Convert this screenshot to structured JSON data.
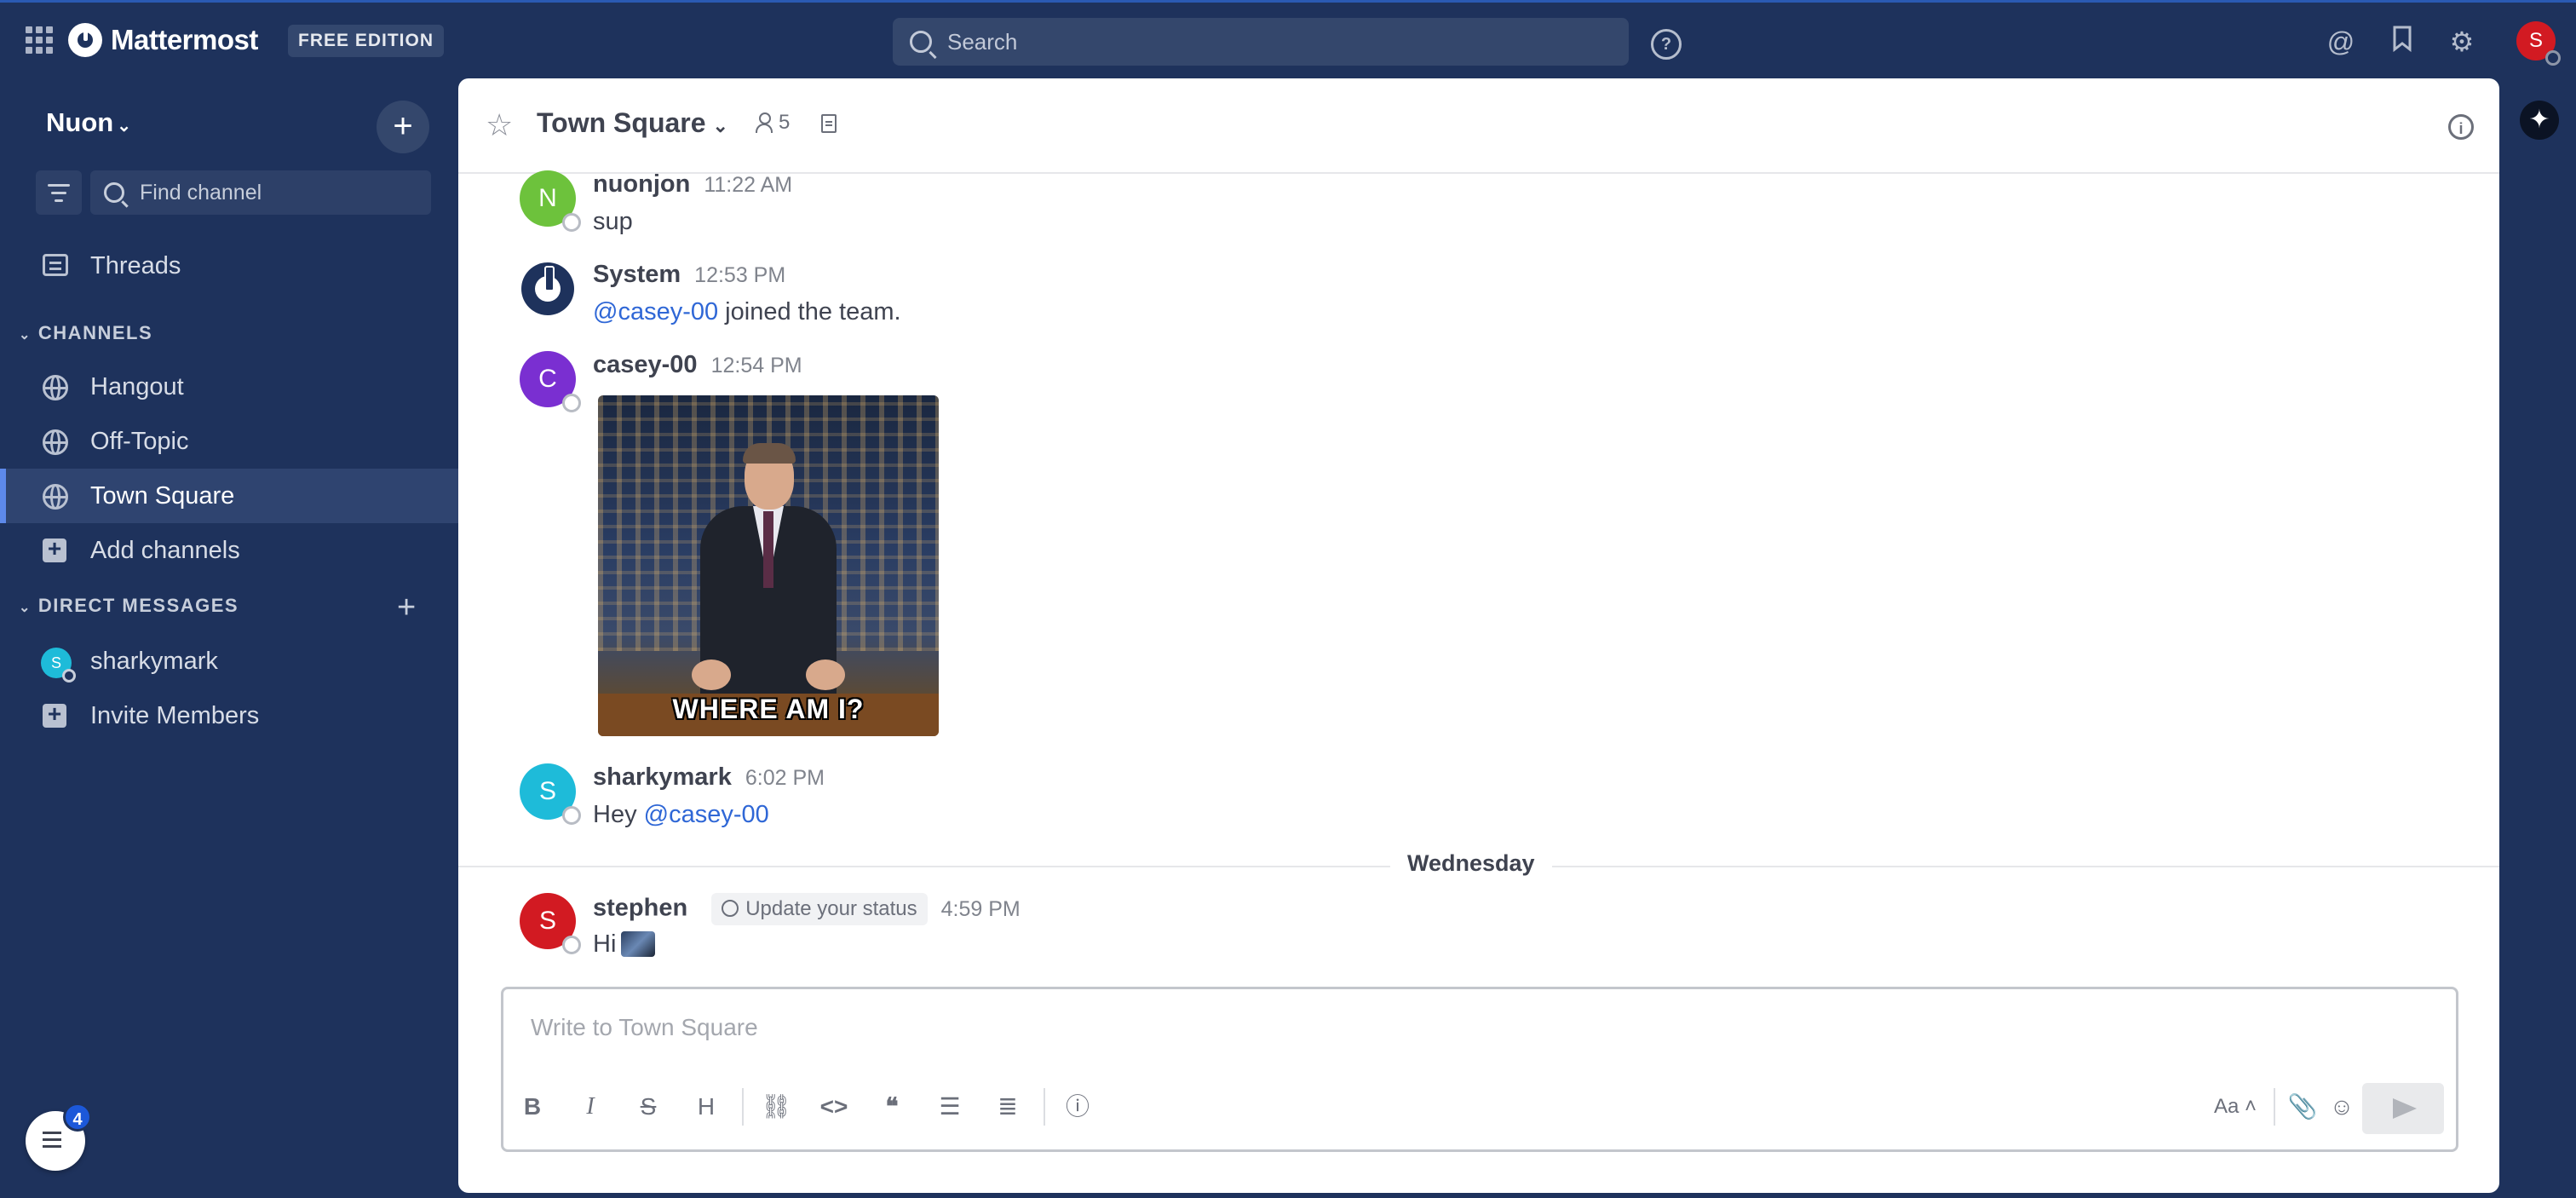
{
  "topbar": {
    "logo_text": "Mattermost",
    "edition": "FREE EDITION",
    "search_placeholder": "Search",
    "help_label": "?",
    "user_initial": "S"
  },
  "sidebar": {
    "team_name": "Nuon",
    "find_channel_placeholder": "Find channel",
    "threads_label": "Threads",
    "channels_header": "CHANNELS",
    "channels": [
      {
        "name": "Hangout"
      },
      {
        "name": "Off-Topic"
      },
      {
        "name": "Town Square",
        "active": true
      }
    ],
    "add_channels_label": "Add channels",
    "dm_header": "DIRECT MESSAGES",
    "dm_users": [
      {
        "name": "sharkymark",
        "initial": "S",
        "color": "#1ebbd9"
      }
    ],
    "invite_label": "Invite Members",
    "insights_badge": "4"
  },
  "channel": {
    "name": "Town Square",
    "member_count": "5",
    "composer_placeholder": "Write to Town Square",
    "font_toggle_label": "Aa"
  },
  "posts": [
    {
      "author": "nuonjon",
      "initial": "N",
      "color": "#6dc23c",
      "time": "11:22 AM",
      "text": "sup"
    },
    {
      "author": "System",
      "time": "12:53 PM",
      "mention": "@casey-00",
      "text": " joined the team."
    },
    {
      "author": "casey-00",
      "initial": "C",
      "color": "#7a2fd1",
      "time": "12:54 PM",
      "gif_caption": "WHERE AM I?"
    },
    {
      "author": "sharkymark",
      "initial": "S",
      "color": "#1ebbd9",
      "time": "6:02 PM",
      "text": "Hey ",
      "mention": "@casey-00"
    }
  ],
  "date_divider": "Wednesday",
  "last_post": {
    "author": "stephen",
    "initial": "S",
    "color": "#d21a22",
    "status_chip": "Update your status",
    "time": "4:59 PM",
    "text": "Hi"
  },
  "icons": {
    "product_menu": "grid-icon",
    "mentions": "at-icon",
    "saved": "bookmark-icon",
    "settings": "gear-icon",
    "ai": "sparkle-icon"
  }
}
